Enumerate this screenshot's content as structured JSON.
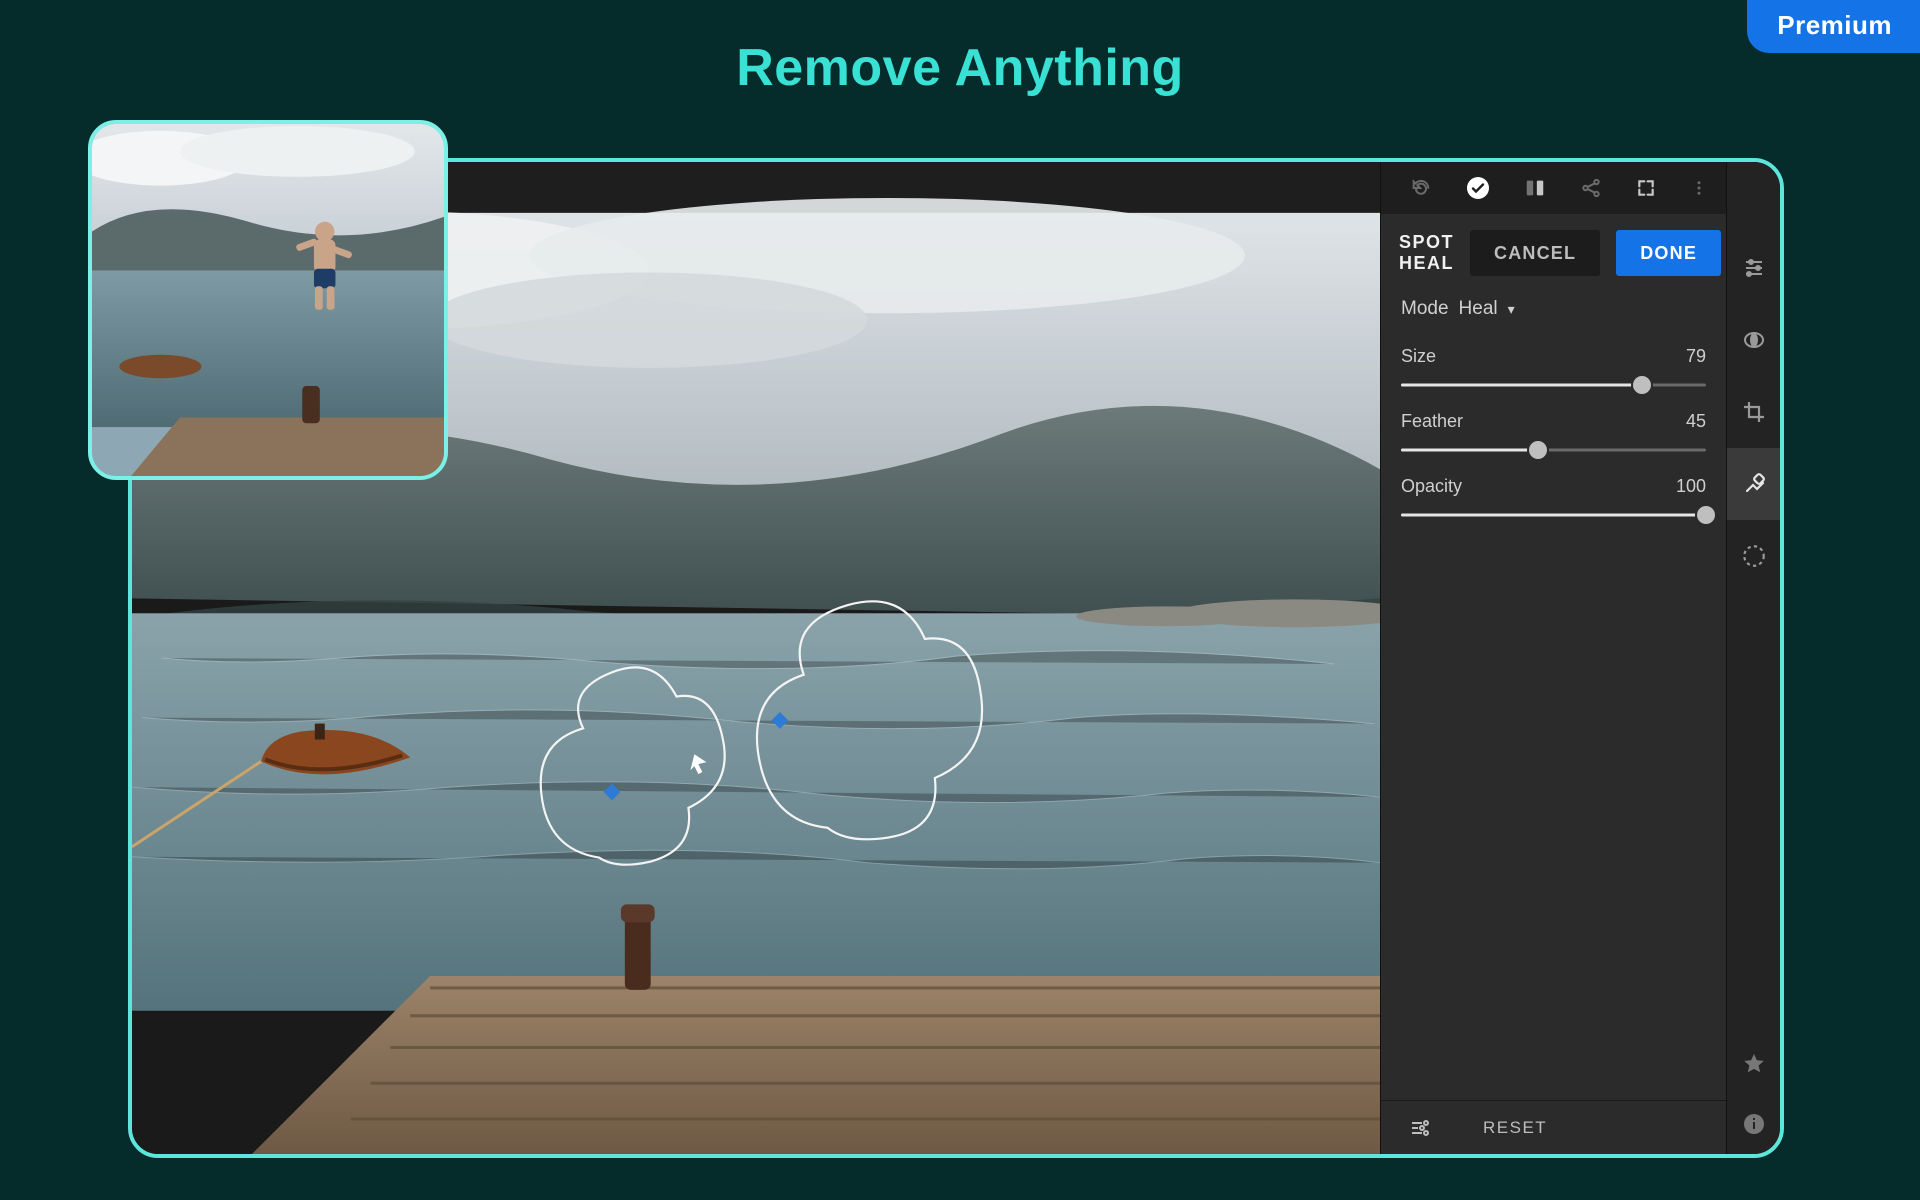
{
  "badge": {
    "label": "Premium"
  },
  "hero": {
    "title": "Remove Anything"
  },
  "toolbar": {
    "cancel_label": "CANCEL",
    "done_label": "DONE"
  },
  "panel": {
    "title": "SPOT HEAL",
    "mode_label": "Mode",
    "mode_value": "Heal",
    "sliders": {
      "size": {
        "label": "Size",
        "value": 79,
        "min": 0,
        "max": 100
      },
      "feather": {
        "label": "Feather",
        "value": 45,
        "min": 0,
        "max": 100
      },
      "opacity": {
        "label": "Opacity",
        "value": 100,
        "min": 0,
        "max": 100
      }
    }
  },
  "footer": {
    "reset_label": "RESET"
  },
  "colors": {
    "accent_teal": "#38e1d4",
    "accent_blue": "#1473e6",
    "panel_bg": "#2b2b2b"
  }
}
